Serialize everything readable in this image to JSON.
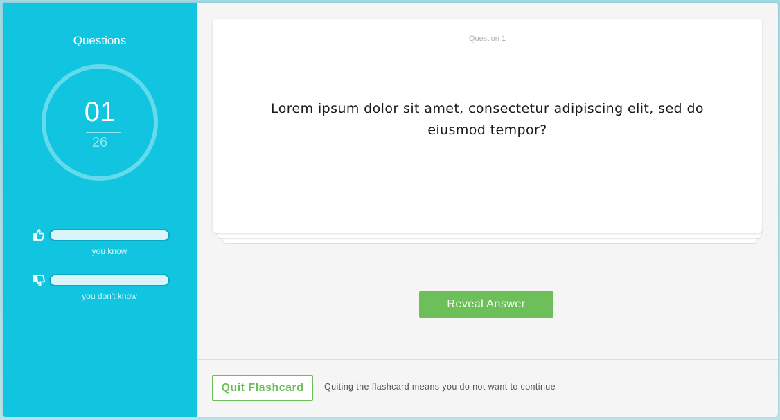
{
  "sidebar": {
    "title": "Questions",
    "progress": {
      "current": "01",
      "total": "26"
    },
    "stats": [
      {
        "label": "you know",
        "value": 0,
        "icon": "thumbs-up-icon"
      },
      {
        "label": "you don't know",
        "value": 0,
        "icon": "thumbs-down-icon"
      }
    ]
  },
  "card": {
    "label": "Question 1",
    "question": "Lorem ipsum dolor sit amet, consectetur adipiscing elit, sed do eiusmod tempor?"
  },
  "actions": {
    "reveal_label": "Reveal Answer"
  },
  "footer": {
    "quit_label": "Quit Flashcard",
    "quit_note": "Quiting the flashcard means you do not want to continue"
  },
  "colors": {
    "sidebar": "#11c5e0",
    "accent_green": "#6cbf59",
    "ring": "#63dbed"
  }
}
